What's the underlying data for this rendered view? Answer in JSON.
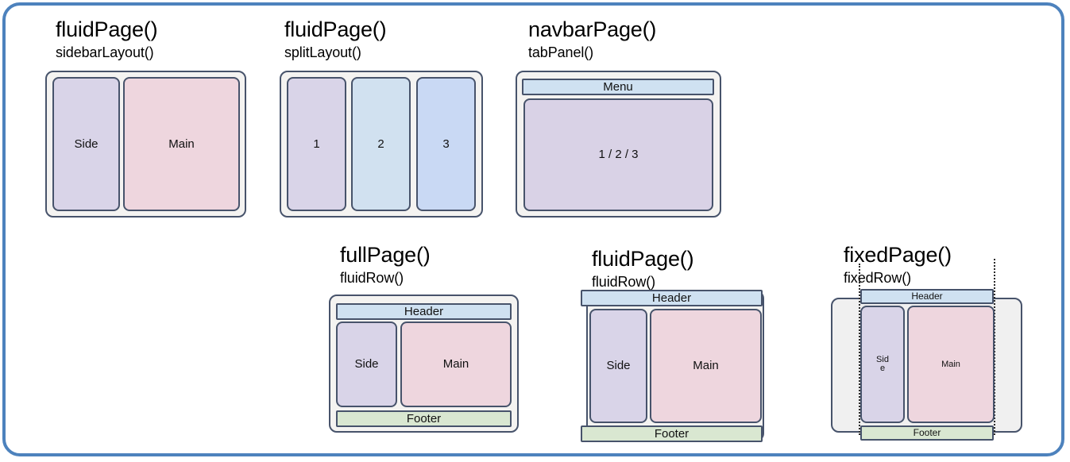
{
  "frame": {
    "border_color": "#4d82bd",
    "background": "#ffffff"
  },
  "palette": {
    "side": "#d9d4e8",
    "main": "#eed6de",
    "panel1": "#d9d4e8",
    "panel2": "#d1e1f0",
    "panel3": "#c9d9f4",
    "menu": "#cfe1f1",
    "header": "#cfe1f1",
    "footer": "#d9e7d1",
    "body": "#d9d2e6",
    "shell": "#f4f3f1",
    "shell_gray": "#f0f0f0",
    "stroke": "#47536b"
  },
  "diagrams": [
    {
      "id": "fluidpage-sidebarlayout",
      "title": "fluidPage()",
      "subtitle": "sidebarLayout()",
      "boxes": [
        {
          "name": "side-panel",
          "label": "Side"
        },
        {
          "name": "main-panel",
          "label": "Main"
        }
      ]
    },
    {
      "id": "fluidpage-splitlayout",
      "title": "fluidPage()",
      "subtitle": "splitLayout()",
      "boxes": [
        {
          "name": "split-panel-1",
          "label": "1"
        },
        {
          "name": "split-panel-2",
          "label": "2"
        },
        {
          "name": "split-panel-3",
          "label": "3"
        }
      ]
    },
    {
      "id": "navbarpage-tabpanel",
      "title": "navbarPage()",
      "subtitle": "tabPanel()",
      "boxes": [
        {
          "name": "menu-bar",
          "label": "Menu"
        },
        {
          "name": "tab-body",
          "label": "1 / 2 / 3"
        }
      ]
    },
    {
      "id": "fullpage-fluidrow",
      "title": "fullPage()",
      "subtitle": "fluidRow()",
      "boxes": [
        {
          "name": "header-bar",
          "label": "Header"
        },
        {
          "name": "side-panel",
          "label": "Side"
        },
        {
          "name": "main-panel",
          "label": "Main"
        },
        {
          "name": "footer-bar",
          "label": "Footer"
        }
      ]
    },
    {
      "id": "fluidpage-fluidrow",
      "title": "fluidPage()",
      "subtitle": "fluidRow()",
      "boxes": [
        {
          "name": "header-bar",
          "label": "Header"
        },
        {
          "name": "side-panel",
          "label": "Side"
        },
        {
          "name": "main-panel",
          "label": "Main"
        },
        {
          "name": "footer-bar",
          "label": "Footer"
        }
      ]
    },
    {
      "id": "fixedpage-fixedrow",
      "title": "fixedPage()",
      "subtitle": "fixedRow()",
      "boxes": [
        {
          "name": "header-bar",
          "label": "Header"
        },
        {
          "name": "side-panel",
          "label": "Side"
        },
        {
          "name": "main-panel",
          "label": "Main"
        },
        {
          "name": "footer-bar",
          "label": "Footer"
        }
      ]
    }
  ]
}
